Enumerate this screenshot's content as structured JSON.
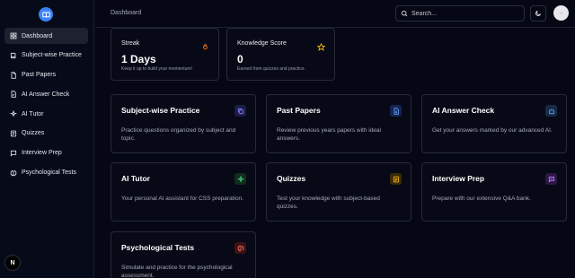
{
  "sidebar": {
    "items": [
      {
        "label": "Dashboard",
        "icon": "grid-icon",
        "active": true
      },
      {
        "label": "Subject-wise Practice",
        "icon": "book-icon"
      },
      {
        "label": "Past Papers",
        "icon": "file-icon"
      },
      {
        "label": "AI Answer Check",
        "icon": "check-file-icon"
      },
      {
        "label": "AI Tutor",
        "icon": "sparkle-icon"
      },
      {
        "label": "Quizzes",
        "icon": "list-icon"
      },
      {
        "label": "Interview Prep",
        "icon": "chat-icon"
      },
      {
        "label": "Psychological Tests",
        "icon": "brain-icon"
      }
    ],
    "footer_badge": "N"
  },
  "header": {
    "breadcrumb": "Dashboard",
    "search_placeholder": "Search..."
  },
  "stats": [
    {
      "title": "Streak",
      "value": "1 Days",
      "sub": "Keep it up to build your momentum!",
      "icon": "flame-icon",
      "color": "#f97316"
    },
    {
      "title": "Knowledge Score",
      "value": "0",
      "sub": "Earned from quizzes and practice.",
      "icon": "star-icon",
      "color": "#eab308"
    }
  ],
  "cards": [
    {
      "title": "Subject-wise Practice",
      "desc": "Practice questions organized by subject and topic.",
      "icon": "copy-icon",
      "color": "#6366f1"
    },
    {
      "title": "Past Papers",
      "desc": "Review previous years papers with ideal answers.",
      "icon": "document-icon",
      "color": "#3b82f6"
    },
    {
      "title": "AI Answer Check",
      "desc": "Get your answers marked by our advanced AI.",
      "icon": "bot-icon",
      "color": "#60a5fa"
    },
    {
      "title": "AI Tutor",
      "desc": "Your personal AI assistant for CSS preparation.",
      "icon": "sparkle-icon",
      "color": "#22c55e"
    },
    {
      "title": "Quizzes",
      "desc": "Test your knowledge with subject-based quizzes.",
      "icon": "quiz-icon",
      "color": "#f59e0b"
    },
    {
      "title": "Interview Prep",
      "desc": "Prepare with our extensive Q&A bank.",
      "icon": "chat-icon",
      "color": "#a855f7"
    },
    {
      "title": "Psychological Tests",
      "desc": "Simulate and practice for the psychological assessment.",
      "icon": "brain-icon",
      "color": "#ef4444"
    }
  ]
}
